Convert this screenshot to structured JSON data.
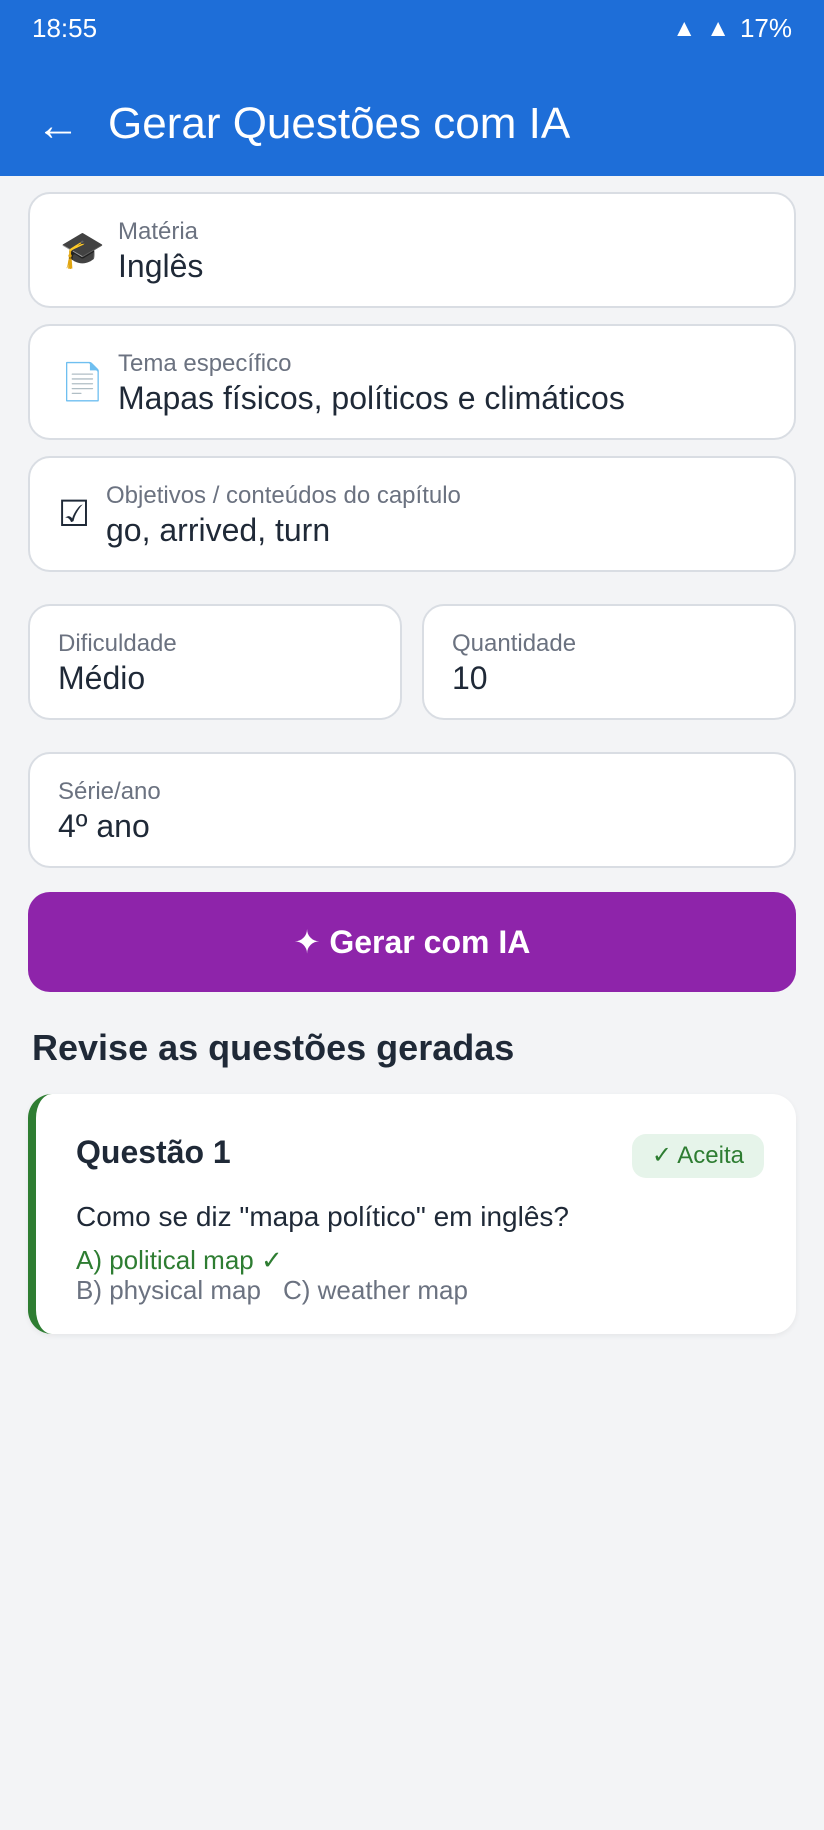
{
  "status_bar": {
    "time": "18:55",
    "wifi_icon": "▲",
    "signal_icon": "▲",
    "battery": "17%"
  },
  "app_bar": {
    "back_icon": "←",
    "title": "Gerar Questões com IA"
  },
  "form": {
    "materia": {
      "icon": "🎓",
      "label": "Matéria",
      "value": "Inglês"
    },
    "tema": {
      "icon": "📄",
      "label": "Tema específico",
      "value": "Mapas físicos, políticos e climáticos"
    },
    "objetivos": {
      "icon": "☑",
      "label": "Objetivos / conteúdos do capítulo",
      "value": "go, arrived, turn"
    },
    "dificuldade": {
      "label": "Dificuldade",
      "value": "Médio"
    },
    "quantidade": {
      "label": "Quantidade",
      "value": "10"
    },
    "serie": {
      "label": "Série/ano",
      "value": "4º ano"
    }
  },
  "generate_button": {
    "label": "✦ Gerar com IA"
  },
  "review": {
    "title": "Revise as questões geradas",
    "questions": [
      {
        "title": "Questão 1",
        "status": "✓ Aceita",
        "text": "Como se diz \"mapa político\" em inglês?",
        "option_a": "A) political map ✓",
        "option_b": "B) physical map",
        "option_c": "C) weather map"
      }
    ]
  },
  "colors": {
    "primary": "#1e6ed8",
    "accent": "#8e24aa",
    "accepted": "#2e7d32"
  }
}
